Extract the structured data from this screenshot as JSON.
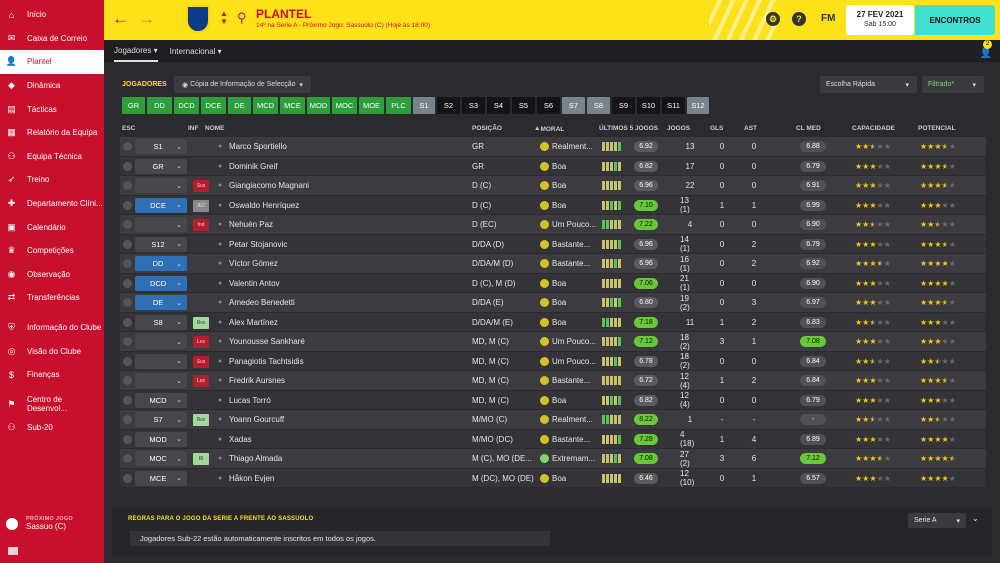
{
  "sidebar": {
    "items": [
      {
        "label": "Início",
        "icon": "house"
      },
      {
        "label": "Caixa de Correio",
        "icon": "envelope"
      },
      {
        "label": "Plantel",
        "icon": "person",
        "active": true
      },
      {
        "label": "Dinâmica",
        "icon": "chart"
      },
      {
        "label": "Tácticas",
        "icon": "clipboard"
      },
      {
        "label": "Relatório da Equipa",
        "icon": "report"
      },
      {
        "label": "Equipa Técnica",
        "icon": "group"
      },
      {
        "label": "Treino",
        "icon": "runner"
      },
      {
        "label": "Departamento Clíni...",
        "icon": "medical"
      },
      {
        "label": "Calendário",
        "icon": "calendar"
      },
      {
        "label": "Competições",
        "icon": "trophy"
      },
      {
        "label": "Observação",
        "icon": "eye"
      },
      {
        "label": "Transferências",
        "icon": "transfer"
      },
      {
        "label": "Informação do Clube",
        "icon": "shield"
      },
      {
        "label": "Visão do Clube",
        "icon": "target"
      },
      {
        "label": "Finanças",
        "icon": "money"
      },
      {
        "label": "Centro de Desenvol...",
        "icon": "development"
      },
      {
        "label": "Sub-20",
        "icon": "youth"
      }
    ],
    "next_game_label": "PRÓXIMO JOGO",
    "next_game_value": "Sassuo (C)"
  },
  "topbar": {
    "title": "PLANTEL",
    "subtitle": "14º na Serie A - Próximo Jogo: Sassuolo (C) (Hoje às 18:00)",
    "fm": "FM",
    "date": "27 FEV 2021",
    "day": "Sab 15:00",
    "continue": "ENCONTROS",
    "accent": "#fde119",
    "brand": "#c8102e"
  },
  "tabs": [
    {
      "label": "Jogadores",
      "active": true
    },
    {
      "label": "Internacional"
    }
  ],
  "badge_count": "2",
  "panel": {
    "section": "JOGADORES",
    "copy_button": "Cópia de Informação de Selecção",
    "quick_pick": "Escolha Rápida",
    "filter": "Filtrado*",
    "position_buttons": [
      {
        "label": "GR",
        "style": "g"
      },
      {
        "label": "DD",
        "style": "g"
      },
      {
        "label": "DCD",
        "style": "g"
      },
      {
        "label": "DCE",
        "style": "g"
      },
      {
        "label": "DE",
        "style": "g"
      },
      {
        "label": "MCD",
        "style": "g"
      },
      {
        "label": "MCE",
        "style": "g"
      },
      {
        "label": "MOD",
        "style": "g"
      },
      {
        "label": "MOC",
        "style": "g"
      },
      {
        "label": "MOE",
        "style": "g"
      },
      {
        "label": "PLC",
        "style": "g"
      },
      {
        "label": "S1",
        "style": "s"
      },
      {
        "label": "S2",
        "style": "b"
      },
      {
        "label": "S3",
        "style": "b"
      },
      {
        "label": "S4",
        "style": "b"
      },
      {
        "label": "S5",
        "style": "b"
      },
      {
        "label": "S6",
        "style": "b"
      },
      {
        "label": "S7",
        "style": "s"
      },
      {
        "label": "S8",
        "style": "s"
      },
      {
        "label": "S9",
        "style": "b"
      },
      {
        "label": "S10",
        "style": "b"
      },
      {
        "label": "S11",
        "style": "b"
      },
      {
        "label": "S12",
        "style": "s"
      }
    ],
    "columns": {
      "esc": "ESC",
      "inf": "INF",
      "nome": "NOME",
      "posicao": "POSIÇÃO",
      "moral": "MORAL",
      "ultimos": "ÚLTIMOS 5 JOGOS",
      "jogos": "JOGOS",
      "gls": "GLS",
      "ast": "AST",
      "clmed": "CL MED",
      "capacidade": "CAPACIDADE",
      "potencial": "POTENCIAL"
    }
  },
  "players": [
    {
      "sel": "S1",
      "blue": false,
      "inf": "",
      "infc": "",
      "name": "Marco Sportiello",
      "pos": "GR",
      "moral": "Realment...",
      "mg": false,
      "avg": "6.92",
      "hi": false,
      "jogos": "13",
      "gls": "0",
      "ast": "0",
      "cm": "6.88",
      "cmhi": false,
      "cap": 2.5,
      "pot": 3.5
    },
    {
      "sel": "GR",
      "blue": false,
      "inf": "",
      "infc": "",
      "name": "Dominik Greif",
      "pos": "GR",
      "moral": "Boa",
      "mg": false,
      "avg": "6.82",
      "hi": false,
      "jogos": "17",
      "gls": "0",
      "ast": "0",
      "cm": "6.79",
      "cmhi": false,
      "cap": 3,
      "pot": 3.5
    },
    {
      "sel": "",
      "blue": false,
      "inf": "Sus",
      "infc": "red",
      "name": "Giangiacomo Magnani",
      "pos": "D (C)",
      "moral": "Boa",
      "mg": false,
      "avg": "6.96",
      "hi": false,
      "jogos": "22",
      "gls": "0",
      "ast": "0",
      "cm": "6.91",
      "cmhi": false,
      "cap": 3,
      "pot": 3.5
    },
    {
      "sel": "DCE",
      "blue": true,
      "inf": "JEC",
      "infc": "gry",
      "name": "Oswaldo Henríquez",
      "pos": "D (C)",
      "moral": "Boa",
      "mg": false,
      "avg": "7.10",
      "hi": true,
      "jogos": "13 (1)",
      "gls": "1",
      "ast": "1",
      "cm": "6.99",
      "cmhi": false,
      "cap": 3,
      "pot": 3
    },
    {
      "sel": "",
      "blue": false,
      "inf": "Ind",
      "infc": "red",
      "name": "Nehuén Paz",
      "pos": "D (EC)",
      "moral": "Um Pouco...",
      "mg": false,
      "avg": "7.22",
      "hi": true,
      "jogos": "4",
      "gls": "0",
      "ast": "0",
      "cm": "6.90",
      "cmhi": false,
      "cap": 2.5,
      "pot": 2.5
    },
    {
      "sel": "S12",
      "blue": false,
      "inf": "",
      "infc": "",
      "name": "Petar Stojanovic",
      "pos": "D/DA (D)",
      "moral": "Bastante...",
      "mg": false,
      "avg": "6.96",
      "hi": false,
      "jogos": "14 (1)",
      "gls": "0",
      "ast": "2",
      "cm": "6.79",
      "cmhi": false,
      "cap": 3,
      "pot": 3.5
    },
    {
      "sel": "DD",
      "blue": true,
      "inf": "",
      "infc": "",
      "name": "Víctor Gómez",
      "pos": "D/DA/M (D)",
      "moral": "Bastante...",
      "mg": false,
      "avg": "6.96",
      "hi": false,
      "jogos": "16 (1)",
      "gls": "0",
      "ast": "2",
      "cm": "6.92",
      "cmhi": false,
      "cap": 3.5,
      "pot": 4
    },
    {
      "sel": "DCD",
      "blue": true,
      "inf": "",
      "infc": "",
      "name": "Valentin Antov",
      "pos": "D (C), M (D)",
      "moral": "Boa",
      "mg": false,
      "avg": "7.06",
      "hi": true,
      "jogos": "21 (1)",
      "gls": "0",
      "ast": "0",
      "cm": "6.90",
      "cmhi": false,
      "cap": 3,
      "pot": 4
    },
    {
      "sel": "DE",
      "blue": true,
      "inf": "",
      "infc": "",
      "name": "Amedeo Benedetti",
      "pos": "D/DA (E)",
      "moral": "Boa",
      "mg": false,
      "avg": "6.80",
      "hi": false,
      "jogos": "19 (2)",
      "gls": "0",
      "ast": "3",
      "cm": "6.97",
      "cmhi": false,
      "cap": 3,
      "pot": 3.5
    },
    {
      "sel": "S8",
      "blue": false,
      "inf": "Rsv",
      "infc": "grn",
      "name": "Alex Martínez",
      "pos": "D/DA/M (E)",
      "moral": "Boa",
      "mg": false,
      "avg": "7.18",
      "hi": true,
      "jogos": "11",
      "gls": "1",
      "ast": "2",
      "cm": "6.83",
      "cmhi": false,
      "cap": 2.5,
      "pot": 3
    },
    {
      "sel": "",
      "blue": false,
      "inf": "Les",
      "infc": "red",
      "name": "Younousse Sankharé",
      "pos": "MD, M (C)",
      "moral": "Um Pouco...",
      "mg": false,
      "avg": "7.12",
      "hi": true,
      "jogos": "18 (2)",
      "gls": "3",
      "ast": "1",
      "cm": "7.08",
      "cmhi": true,
      "cap": 3,
      "pot": 3
    },
    {
      "sel": "",
      "blue": false,
      "inf": "Sus",
      "infc": "red",
      "name": "Panagiotis Tachtsidis",
      "pos": "MD, M (C)",
      "moral": "Um Pouco...",
      "mg": false,
      "avg": "6.78",
      "hi": false,
      "jogos": "18 (2)",
      "gls": "0",
      "ast": "0",
      "cm": "6.84",
      "cmhi": false,
      "cap": 2.5,
      "pot": 2.5
    },
    {
      "sel": "",
      "blue": false,
      "inf": "Les",
      "infc": "red",
      "name": "Fredrik Aursnes",
      "pos": "MD, M (C)",
      "moral": "Bastante...",
      "mg": false,
      "avg": "6.72",
      "hi": false,
      "jogos": "12 (4)",
      "gls": "1",
      "ast": "2",
      "cm": "6.84",
      "cmhi": false,
      "cap": 3,
      "pot": 3.5
    },
    {
      "sel": "MCD",
      "blue": false,
      "inf": "",
      "infc": "",
      "name": "Lucas Torró",
      "pos": "MD, M (C)",
      "moral": "Boa",
      "mg": false,
      "avg": "6.82",
      "hi": false,
      "jogos": "12 (4)",
      "gls": "0",
      "ast": "0",
      "cm": "6.79",
      "cmhi": false,
      "cap": 3,
      "pot": 3
    },
    {
      "sel": "S7",
      "blue": false,
      "inf": "Rsv",
      "infc": "grn",
      "name": "Yoann Gourcuff",
      "pos": "M/MO (C)",
      "moral": "Realment...",
      "mg": false,
      "avg": "8.22",
      "hi": true,
      "jogos": "1",
      "gls": "-",
      "ast": "-",
      "cm": "-",
      "cmhi": false,
      "cap": 2.5,
      "pot": 2.5
    },
    {
      "sel": "MOD",
      "blue": false,
      "inf": "",
      "infc": "",
      "name": "Xadas",
      "pos": "M/MO (DC)",
      "moral": "Bastante...",
      "mg": false,
      "avg": "7.28",
      "hi": true,
      "jogos": "4 (18)",
      "gls": "1",
      "ast": "4",
      "cm": "6.89",
      "cmhi": false,
      "cap": 3,
      "pot": 4
    },
    {
      "sel": "MOC",
      "blue": false,
      "inf": "Rl",
      "infc": "grn",
      "name": "Thiago Almada",
      "pos": "M (C), MO (DE...",
      "moral": "Extremam...",
      "mg": true,
      "avg": "7.08",
      "hi": true,
      "jogos": "27 (2)",
      "gls": "3",
      "ast": "6",
      "cm": "7.12",
      "cmhi": true,
      "cap": 3.5,
      "pot": 4.5
    },
    {
      "sel": "MCE",
      "blue": false,
      "inf": "",
      "infc": "",
      "name": "Håkon Evjen",
      "pos": "M (DC), MO (DE)",
      "moral": "Boa",
      "mg": false,
      "avg": "6.46",
      "hi": false,
      "jogos": "12 (10)",
      "gls": "0",
      "ast": "1",
      "cm": "6.57",
      "cmhi": false,
      "cap": 3,
      "pot": 4
    }
  ],
  "rules": {
    "title": "REGRAS PARA O JOGO DA SERIE A FRENTE AO SASSUOLO",
    "competition": "Serie A",
    "text": "Jogadores Sub-22 estão automaticamente inscritos em todos os jogos."
  }
}
